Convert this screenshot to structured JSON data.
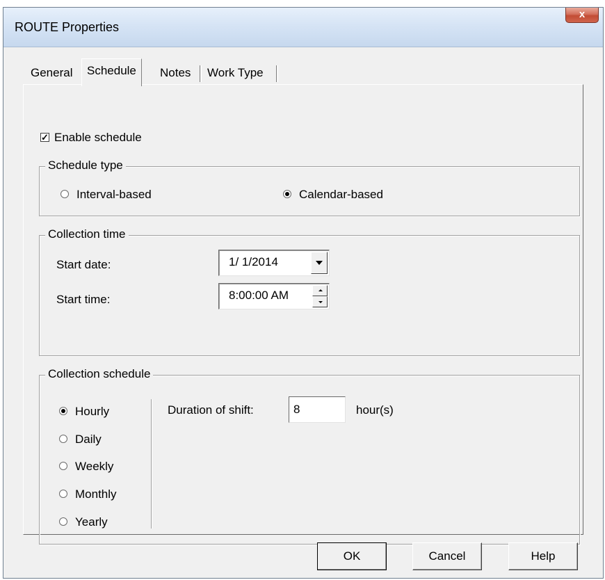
{
  "window": {
    "title": "ROUTE Properties",
    "close_glyph": "x"
  },
  "tabs": [
    {
      "label": "General",
      "active": false
    },
    {
      "label": "Schedule",
      "active": true
    },
    {
      "label": "Notes",
      "active": false
    },
    {
      "label": "Work Type",
      "active": false
    }
  ],
  "enable_schedule": {
    "label": "Enable schedule",
    "checked": true,
    "check_glyph": "✓"
  },
  "schedule_type": {
    "title": "Schedule type",
    "options": [
      {
        "label": "Interval-based",
        "checked": false
      },
      {
        "label": "Calendar-based",
        "checked": true
      }
    ]
  },
  "collection_time": {
    "title": "Collection time",
    "start_date_label": "Start date:",
    "start_date_value": "1/ 1/2014",
    "start_time_label": "Start time:",
    "start_time_value": "8:00:00 AM"
  },
  "collection_schedule": {
    "title": "Collection schedule",
    "options": [
      {
        "label": "Hourly",
        "checked": true
      },
      {
        "label": "Daily",
        "checked": false
      },
      {
        "label": "Weekly",
        "checked": false
      },
      {
        "label": "Monthly",
        "checked": false
      },
      {
        "label": "Yearly",
        "checked": false
      }
    ],
    "duration_label": "Duration of shift:",
    "duration_value": "8",
    "duration_unit": "hour(s)"
  },
  "buttons": {
    "ok": "OK",
    "cancel": "Cancel",
    "help": "Help"
  }
}
